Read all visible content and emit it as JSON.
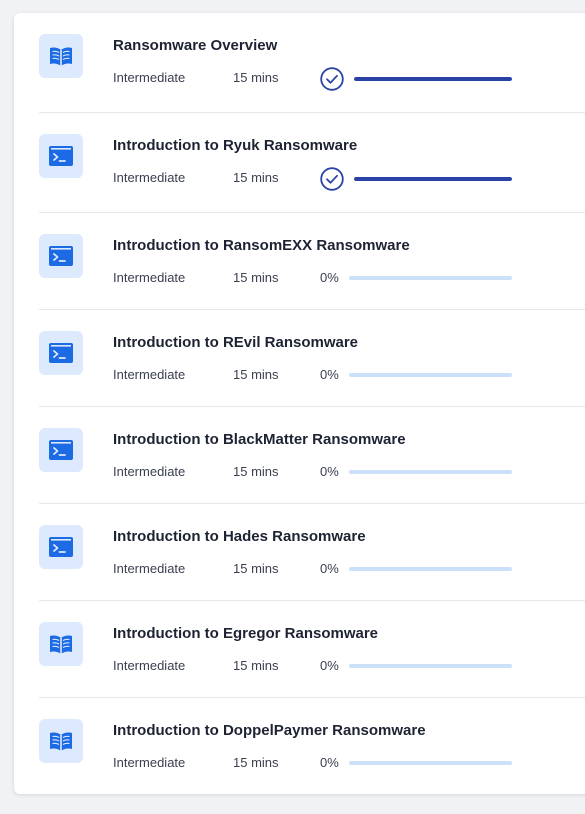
{
  "colors": {
    "icon_bg": "#dde9fc",
    "icon_fg": "#1d6ae5",
    "progress_done": "#2942a6",
    "progress_track": "#cde0f9"
  },
  "modules": [
    {
      "title": "Ransomware Overview",
      "level": "Intermediate",
      "duration": "15 mins",
      "icon": "book-icon",
      "completed": true,
      "progress": 1.0,
      "percent_label": ""
    },
    {
      "title": "Introduction to Ryuk Ransomware",
      "level": "Intermediate",
      "duration": "15 mins",
      "icon": "terminal-icon",
      "completed": true,
      "progress": 1.0,
      "percent_label": ""
    },
    {
      "title": "Introduction to RansomEXX Ransomware",
      "level": "Intermediate",
      "duration": "15 mins",
      "icon": "terminal-icon",
      "completed": false,
      "progress": 0,
      "percent_label": "0%"
    },
    {
      "title": "Introduction to REvil Ransomware",
      "level": "Intermediate",
      "duration": "15 mins",
      "icon": "terminal-icon",
      "completed": false,
      "progress": 0,
      "percent_label": "0%"
    },
    {
      "title": "Introduction to BlackMatter Ransomware",
      "level": "Intermediate",
      "duration": "15 mins",
      "icon": "terminal-icon",
      "completed": false,
      "progress": 0,
      "percent_label": "0%"
    },
    {
      "title": "Introduction to Hades Ransomware",
      "level": "Intermediate",
      "duration": "15 mins",
      "icon": "terminal-icon",
      "completed": false,
      "progress": 0,
      "percent_label": "0%"
    },
    {
      "title": "Introduction to Egregor Ransomware",
      "level": "Intermediate",
      "duration": "15 mins",
      "icon": "book-icon",
      "completed": false,
      "progress": 0,
      "percent_label": "0%"
    },
    {
      "title": "Introduction to DoppelPaymer Ransomware",
      "level": "Intermediate",
      "duration": "15 mins",
      "icon": "book-icon",
      "completed": false,
      "progress": 0,
      "percent_label": "0%"
    }
  ]
}
